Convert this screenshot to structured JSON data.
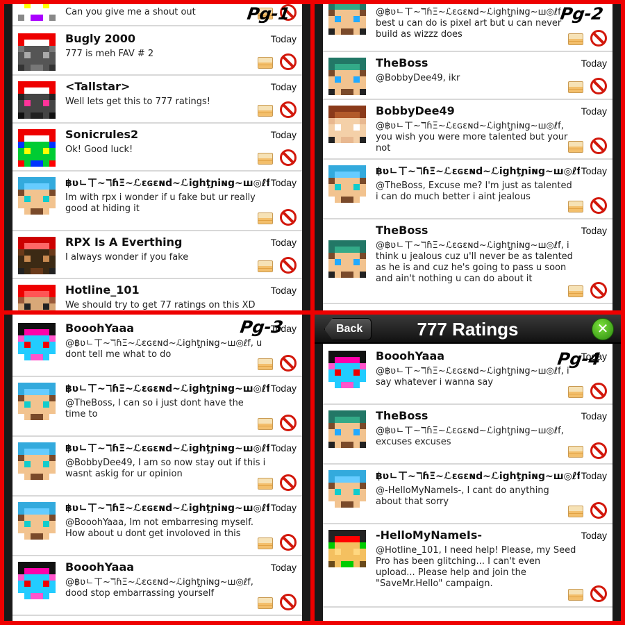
{
  "app": {
    "title": "777 Ratings",
    "back_label": "Back",
    "settings_icon": "wrench-screwdriver-icon",
    "accent": "#2c8a10",
    "block_color": "#d2180c"
  },
  "pages": [
    {
      "label": "Pg-1",
      "messages": [
        {
          "name": "",
          "time": "",
          "text": "Can you give me a shout out",
          "avatar": "c1"
        },
        {
          "name": "Bugly 2000",
          "time": "Today",
          "text": "777 is meh FAV # 2",
          "avatar": "c2"
        },
        {
          "name": "<Tallstar>",
          "time": "Today",
          "text": "Well lets get this to 777 ratings!",
          "avatar": "c3"
        },
        {
          "name": "Sonicrules2",
          "time": "Today",
          "text": "Ok! Good luck!",
          "avatar": "c4"
        },
        {
          "name": "฿ʋㄴㄒ~ℸɦΞ~ℒɛɢɛɴd~ℒighţɲiɴg~ꟺ◎ℓf",
          "time": "Today",
          "text": "Im with rpx i wonder if u fake but ur really good at hiding it",
          "avatar": "c5"
        },
        {
          "name": "RPX Is A Everthing",
          "time": "Today",
          "text": "I always wonder if you fake",
          "avatar": "c6"
        },
        {
          "name": "Hotline_101",
          "time": "Today",
          "text": "We should try to get 77 ratings on this XD",
          "avatar": "c7"
        }
      ]
    },
    {
      "label": "Pg-2",
      "messages": [
        {
          "name": "",
          "time": "",
          "text": "@฿ʋㄴㄒ~ℸɦΞ~ℒɛɢɛɴd~ℒighţɲiɴg~ꟺ◎ℓf, best u can do is pixel art but u can never build as wizzz does",
          "avatar": "c8"
        },
        {
          "name": "TheBoss",
          "time": "Today",
          "text": "@BobbyDee49, ikr",
          "avatar": "c8"
        },
        {
          "name": "BobbyDee49",
          "time": "Today",
          "text": "@฿ʋㄴㄒ~ℸɦΞ~ℒɛɢɛɴd~ℒighţɲiɴg~ꟺ◎ℓf, you wish you were more talented but your not",
          "avatar": "c9"
        },
        {
          "name": "฿ʋㄴㄒ~ℸɦΞ~ℒɛɢɛɴd~ℒighţɲiɴg~ꟺ◎ℓf",
          "time": "Today",
          "text": "@TheBoss, Excuse me? I'm just as talented i can do much better i aint jealous",
          "avatar": "c5"
        },
        {
          "name": "TheBoss",
          "time": "Today",
          "text": "@฿ʋㄴㄒ~ℸɦΞ~ℒɛɢɛɴd~ℒighţɲiɴg~ꟺ◎ℓf, i think u jealous cuz u'll never be as talented as he is and cuz he's going to pass u soon and ain't nothing u can do about it",
          "avatar": "c8"
        }
      ]
    },
    {
      "label": "Pg-3",
      "messages": [
        {
          "name": "BooohYaaa",
          "time": "Today",
          "text": "@฿ʋㄴㄒ~ℸɦΞ~ℒɛɢɛɴd~ℒighţɲiɴg~ꟺ◎ℓf, u dont tell me what to do",
          "avatar": "c10"
        },
        {
          "name": "฿ʋㄴㄒ~ℸɦΞ~ℒɛɢɛɴd~ℒighţɲiɴg~ꟺ◎ℓf",
          "time": "Today",
          "text": "@TheBoss, I can so i just dont have the time to",
          "avatar": "c5"
        },
        {
          "name": "฿ʋㄴㄒ~ℸɦΞ~ℒɛɢɛɴd~ℒighţɲiɴg~ꟺ◎ℓf",
          "time": "Today",
          "text": "@BobbyDee49, I am so now stay out if this i wasnt askig for ur opinion",
          "avatar": "c5"
        },
        {
          "name": "฿ʋㄴㄒ~ℸɦΞ~ℒɛɢɛɴd~ℒighţɲiɴg~ꟺ◎ℓf",
          "time": "Today",
          "text": "@BooohYaaa, Im not embarresing myself. How about u dont get involoved in this",
          "avatar": "c5"
        },
        {
          "name": "BooohYaaa",
          "time": "Today",
          "text": "@฿ʋㄴㄒ~ℸɦΞ~ℒɛɢɛɴd~ℒighţɲiɴg~ꟺ◎ℓf, dood stop embarrassing yourself",
          "avatar": "c10"
        }
      ]
    },
    {
      "label": "Pg-4",
      "messages": [
        {
          "name": "BooohYaaa",
          "time": "Today",
          "text": "@฿ʋㄴㄒ~ℸɦΞ~ℒɛɢɛɴd~ℒighţɲiɴg~ꟺ◎ℓf, i say whatever i wanna say",
          "avatar": "c10"
        },
        {
          "name": "TheBoss",
          "time": "Today",
          "text": "@฿ʋㄴㄒ~ℸɦΞ~ℒɛɢɛɴd~ℒighţɲiɴg~ꟺ◎ℓf, excuses excuses",
          "avatar": "c8"
        },
        {
          "name": "฿ʋㄴㄒ~ℸɦΞ~ℒɛɢɛɴd~ℒighţɲiɴg~ꟺ◎ℓf",
          "time": "Today",
          "text": "@-HelloMyNameIs-, I cant do anything about that sorry",
          "avatar": "c5"
        },
        {
          "name": "-HelloMyNameIs-",
          "time": "Today",
          "text": "@Hotline_101, I need help! Please, my Seed Pro has been glitching... I can't even upload... Please help and join the \"SaveMr.Hello\" campaign.",
          "avatar": "c11"
        }
      ]
    }
  ],
  "avatar_palettes": {
    "c1": [
      "#222",
      "#f7d",
      "#a0f",
      "#fff",
      "#ff0",
      "#888"
    ],
    "c2": [
      "#e00",
      "#fff",
      "#777",
      "#555",
      "#aaa",
      "#333"
    ],
    "c3": [
      "#e00",
      "#fff",
      "#222",
      "#444",
      "#f39",
      "#111"
    ],
    "c4": [
      "#e00",
      "#fff",
      "#03f",
      "#0c3",
      "#ff0",
      "#f00"
    ],
    "c5": [
      "#3ad",
      "#6cf",
      "#7a4a2a",
      "#f2c38f",
      "#1cc",
      "#fff"
    ],
    "c6": [
      "#c00",
      "#f66",
      "#6b3a1a",
      "#3c2a14",
      "#c98a50",
      "#222"
    ],
    "c7": [
      "#e00",
      "#f55",
      "#9a5a3a",
      "#d8a878",
      "#222",
      "#fff"
    ],
    "c8": [
      "#276",
      "#3a8",
      "#7a4a2a",
      "#f2c38f",
      "#2af",
      "#222"
    ],
    "c9": [
      "#8a3a1a",
      "#b25a2a",
      "#e8b890",
      "#f4d0a8",
      "#fff",
      "#222"
    ],
    "c10": [
      "#111",
      "#f0a",
      "#f5c",
      "#2cf",
      "#e00",
      "#fff"
    ],
    "c11": [
      "#222",
      "#f00",
      "#0c0",
      "#f4c060",
      "#ffd880",
      "#6a4a1a"
    ]
  }
}
